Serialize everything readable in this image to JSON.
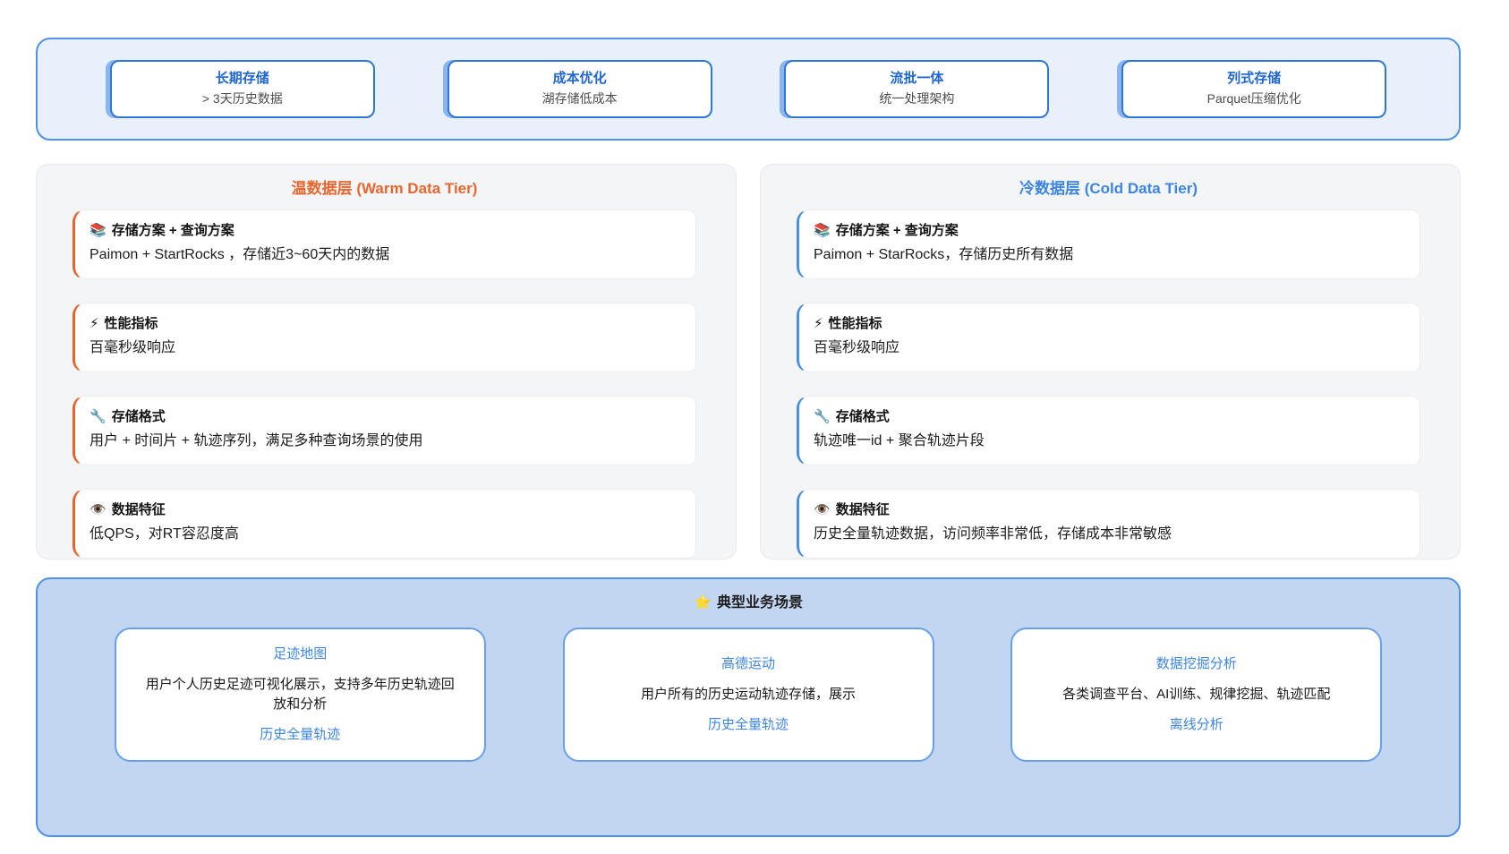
{
  "banner": {
    "items": [
      {
        "title": "长期存储",
        "subtitle": "> 3天历史数据"
      },
      {
        "title": "成本优化",
        "subtitle": "湖存储低成本"
      },
      {
        "title": "流批一体",
        "subtitle": "统一处理架构"
      },
      {
        "title": "列式存储",
        "subtitle": "Parquet压缩优化"
      }
    ]
  },
  "tiers": [
    {
      "title": "温数据层 (Warm Data Tier)",
      "accent_color": "#E8622C",
      "title_color": "#E8662E",
      "cards": [
        {
          "icon": "📚",
          "icon_name": "books-icon",
          "title": "存储方案 + 查询方案",
          "body": "Paimon + StartRocks ，存储近3~60天内的数据"
        },
        {
          "icon": "⚡",
          "icon_name": "lightning-icon",
          "title": "性能指标",
          "body": "百毫秒级响应"
        },
        {
          "icon": "🔧",
          "icon_name": "wrench-icon",
          "title": "存储格式",
          "body": "用户 + 时间片 + 轨迹序列，满足多种查询场景的使用"
        },
        {
          "icon": "👁️",
          "icon_name": "eye-icon",
          "title": "数据特征",
          "body": "低QPS，对RT容忍度高"
        }
      ]
    },
    {
      "title": "冷数据层 (Cold Data Tier)",
      "accent_color": "#4A90E2",
      "title_color": "#3C85E4",
      "cards": [
        {
          "icon": "📚",
          "icon_name": "books-icon",
          "title": "存储方案 + 查询方案",
          "body": "Paimon + StarRocks，存储历史所有数据"
        },
        {
          "icon": "⚡",
          "icon_name": "lightning-icon",
          "title": "性能指标",
          "body": "百毫秒级响应"
        },
        {
          "icon": "🔧",
          "icon_name": "wrench-icon",
          "title": "存储格式",
          "body": "轨迹唯一id + 聚合轨迹片段"
        },
        {
          "icon": "👁️",
          "icon_name": "eye-icon",
          "title": "数据特征",
          "body": "历史全量轨迹数据，访问频率非常低，存储成本非常敏感"
        }
      ]
    }
  ],
  "scenarios": {
    "icon": "⭐",
    "title": "典型业务场景",
    "cards": [
      {
        "title": "足迹地图",
        "body": "用户个人历史足迹可视化展示，支持多年历史轨迹回放和分析",
        "tag": "历史全量轨迹"
      },
      {
        "title": "高德运动",
        "body": "用户所有的历史运动轨迹存储，展示",
        "tag": "历史全量轨迹"
      },
      {
        "title": "数据挖掘分析",
        "body": "各类调查平台、AI训练、规律挖掘、轨迹匹配",
        "tag": "离线分析"
      }
    ]
  },
  "colors": {
    "banner_bg": "#E8F0FC",
    "banner_border": "#4F92E6",
    "banner_card_border": "#2E77D6",
    "banner_card_shadow": "#8AB5F1",
    "banner_title_text": "#1F66D2",
    "panel_bg": "#F4F5F7",
    "warm_accent": "#E8622C",
    "cold_accent": "#4A90E2",
    "scenarios_bg": "#C2D6F2",
    "scenario_card_border": "#66A1E8",
    "scenario_link_text": "#3C85E4"
  }
}
